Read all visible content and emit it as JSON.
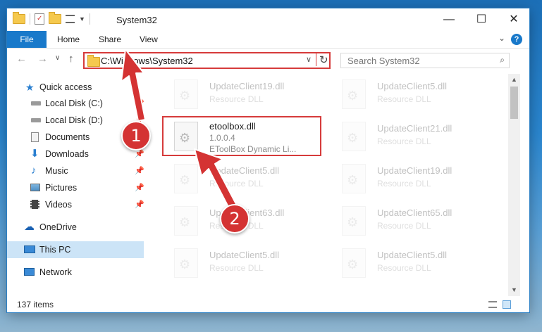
{
  "window": {
    "title": "System32",
    "minimize": "—",
    "maximize": "☐",
    "close": "✕"
  },
  "ribbon": {
    "tabs": [
      "File",
      "Home",
      "Share",
      "View"
    ],
    "help": "?"
  },
  "address": {
    "path": "C:\\Windows\\System32",
    "search_placeholder": "Search System32"
  },
  "sidebar": {
    "items": [
      {
        "label": "Quick access",
        "icon": "star-icon",
        "pinned": false
      },
      {
        "label": "Local Disk (C:)",
        "icon": "drive-icon",
        "pinned": true
      },
      {
        "label": "Local Disk (D:)",
        "icon": "drive-icon",
        "pinned": true
      },
      {
        "label": "Documents",
        "icon": "documents-icon",
        "pinned": true
      },
      {
        "label": "Downloads",
        "icon": "download-icon",
        "pinned": true
      },
      {
        "label": "Music",
        "icon": "music-icon",
        "pinned": true
      },
      {
        "label": "Pictures",
        "icon": "pictures-icon",
        "pinned": true
      },
      {
        "label": "Videos",
        "icon": "videos-icon",
        "pinned": true
      },
      {
        "label": "OneDrive",
        "icon": "cloud-icon",
        "pinned": false
      },
      {
        "label": "This PC",
        "icon": "computer-icon",
        "pinned": false,
        "selected": true
      },
      {
        "label": "Network",
        "icon": "network-icon",
        "pinned": false
      }
    ]
  },
  "files": {
    "left": [
      {
        "name": "UpdateClient19.dll",
        "desc": "Resource DLL"
      },
      {
        "name": "etoolbox.dll",
        "version": "1.0.0.4",
        "desc": "EToolBox Dynamic Li..."
      },
      {
        "name": "UpdateClient5.dll",
        "desc": "Resource DLL"
      },
      {
        "name": "UpdateClient63.dll",
        "desc": "Resource DLL"
      },
      {
        "name": "UpdateClient5.dll",
        "desc": "Resource DLL"
      }
    ],
    "right": [
      {
        "name": "UpdateClient5.dll",
        "desc": "Resource DLL"
      },
      {
        "name": "UpdateClient21.dll",
        "desc": "Resource DLL"
      },
      {
        "name": "UpdateClient19.dll",
        "desc": "Resource DLL"
      },
      {
        "name": "UpdateClient65.dll",
        "desc": "Resource DLL"
      },
      {
        "name": "UpdateClient5.dll",
        "desc": "Resource DLL"
      }
    ]
  },
  "status": {
    "count": "137 items"
  },
  "callouts": [
    "1",
    "2"
  ],
  "colors": {
    "accent": "#1979ca",
    "highlight": "#d63b3b",
    "selected": "#cce4f7"
  }
}
